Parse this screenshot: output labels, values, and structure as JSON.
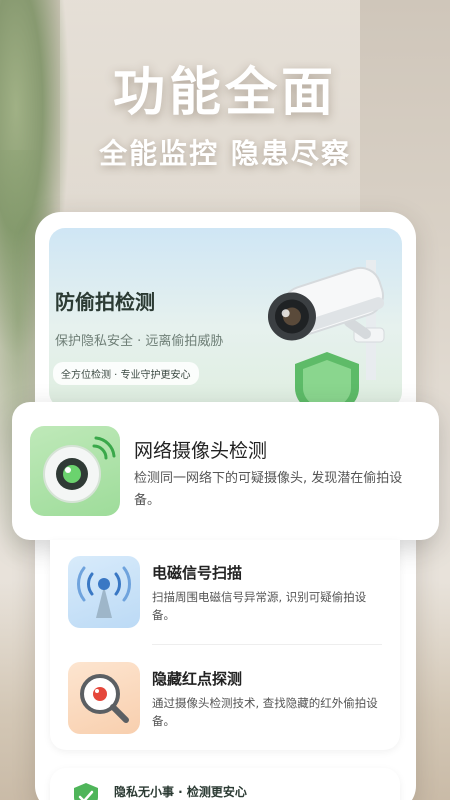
{
  "banner": {
    "headline": "功能全面",
    "subheadline": "全能监控 隐患尽察"
  },
  "hero": {
    "title": "防偷拍检测",
    "subtitle": "保护隐私安全 · 远离偷拍威胁",
    "tag": "全方位检测 · 专业守护更安心"
  },
  "features": {
    "highlighted": {
      "title": "网络摄像头检测",
      "description": "检测同一网络下的可疑摄像头, 发现潜在偷拍设备。",
      "icon": "eye-camera-icon"
    },
    "items": [
      {
        "title": "电磁信号扫描",
        "description": "扫描周围电磁信号异常源, 识别可疑偷拍设备。",
        "icon": "signal-tower-icon"
      },
      {
        "title": "隐藏红点探测",
        "description": "通过摄像头检测技术, 查找隐藏的红外偷拍设备。",
        "icon": "magnifier-red-dot-icon"
      }
    ]
  },
  "footer": {
    "text": "隐私无小事 · 检测更安心",
    "icon": "shield-check-icon"
  },
  "colors": {
    "accent_green": "#4fb55a",
    "title_dark": "#222222"
  }
}
